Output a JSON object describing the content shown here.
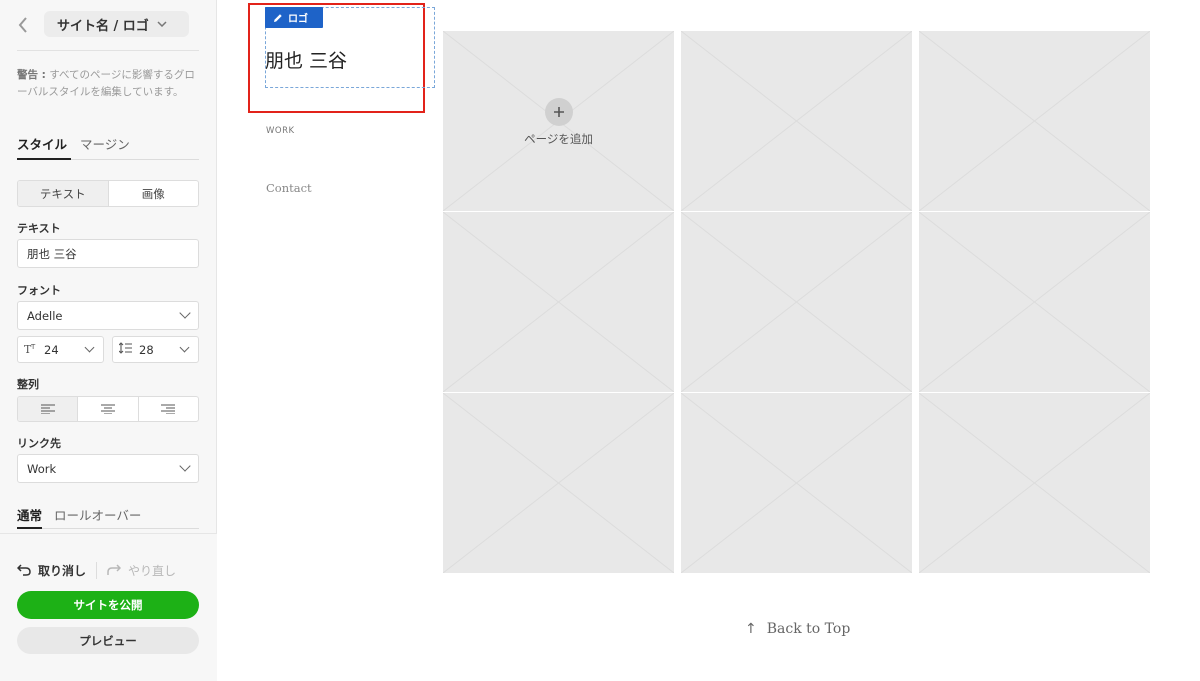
{
  "sidebar": {
    "title": "サイト名 / ロゴ",
    "warning_bold": "警告 :",
    "warning_text": " すべてのページに影響するグローバルスタイルを編集しています。",
    "tabs": [
      "スタイル",
      "マージン"
    ],
    "segment": [
      "テキスト",
      "画像"
    ],
    "text_label": "テキスト",
    "text_value": "朋也 三谷",
    "font_label": "フォント",
    "font_value": "Adelle",
    "size_value": "24",
    "line_height_value": "28",
    "align_label": "整列",
    "link_label": "リンク先",
    "link_value": "Work",
    "state_tabs": [
      "通常",
      "ロールオーバー"
    ]
  },
  "footer": {
    "undo": "取り消し",
    "redo": "やり直し",
    "publish": "サイトを公開",
    "preview": "プレビュー"
  },
  "canvas": {
    "logo_tag": "ロゴ",
    "logo_text": "朋也 三谷",
    "nav": [
      "WORK",
      "Contact"
    ],
    "add_page": "ページを追加",
    "back_to_top": "Back to Top"
  },
  "colors": {
    "publish": "#1db116",
    "tag": "#1e63c8",
    "highlight": "#e2231a"
  }
}
